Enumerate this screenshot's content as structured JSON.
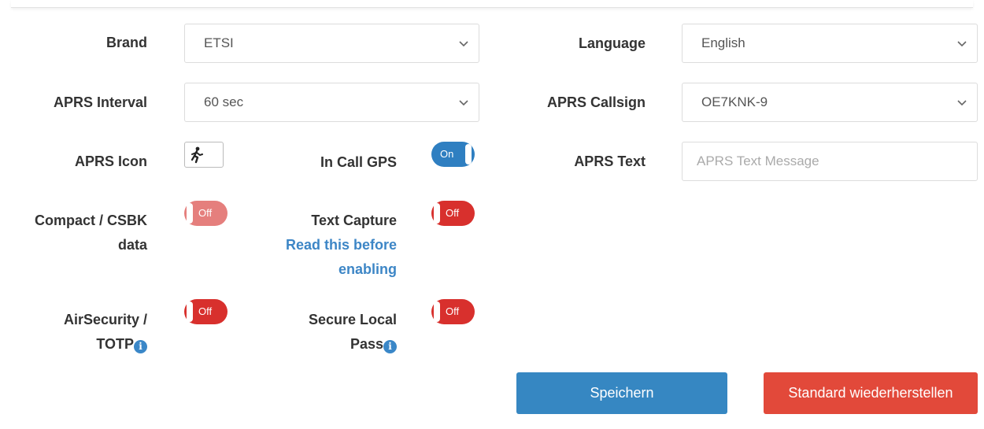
{
  "form": {
    "brand": {
      "label": "Brand",
      "value": "ETSI"
    },
    "language": {
      "label": "Language",
      "value": "English"
    },
    "aprs_interval": {
      "label": "APRS Interval",
      "value": "60 sec"
    },
    "aprs_callsign": {
      "label": "APRS Callsign",
      "value": "OE7KNK-9"
    },
    "aprs_icon": {
      "label": "APRS Icon",
      "icon": "running-person-icon"
    },
    "in_call_gps": {
      "label": "In Call GPS",
      "state": "On"
    },
    "aprs_text": {
      "label": "APRS Text",
      "placeholder": "APRS Text Message"
    },
    "compact_csbk": {
      "label_line1": "Compact / CSBK",
      "label_line2": "data",
      "state": "Off"
    },
    "text_capture": {
      "label": "Text Capture",
      "link_line1": "Read this before",
      "link_line2": "enabling",
      "state": "Off"
    },
    "air_security": {
      "label_line1": "AirSecurity /",
      "label_line2": "TOTP",
      "state": "Off",
      "info_icon": "i"
    },
    "secure_local_pass": {
      "label_line1": "Secure Local",
      "label_line2": "Pass",
      "state": "Off",
      "info_icon": "i"
    }
  },
  "buttons": {
    "save": "Speichern",
    "restore": "Standard wiederherstellen"
  },
  "colors": {
    "toggle_on": "#2f7fc1",
    "toggle_off": "#d8302d",
    "link": "#3d86c6",
    "save_button": "#3687c2",
    "restore_button": "#e2493a"
  }
}
